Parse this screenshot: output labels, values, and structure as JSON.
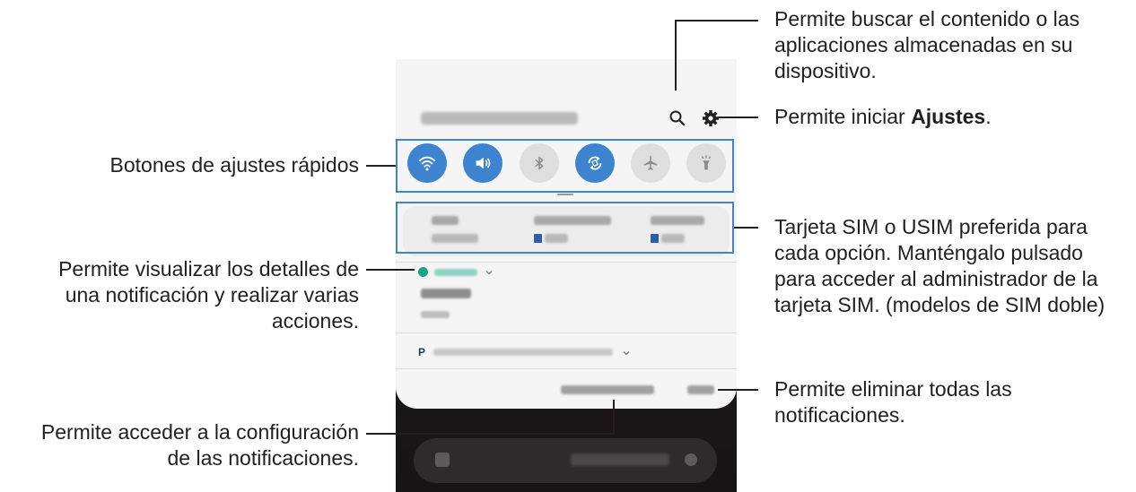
{
  "annotations": {
    "search": {
      "line1": "Permite buscar el contenido o las",
      "line2": "aplicaciones almacenadas en su",
      "line3": "dispositivo."
    },
    "settings": {
      "prefix": "Permite iniciar ",
      "bold": "Ajustes",
      "suffix": "."
    },
    "quick_settings": "Botones de ajustes rápidos",
    "sim": {
      "line1": "Tarjeta SIM o USIM preferida para",
      "line2": "cada opción. Manténgalo pulsado",
      "line3": "para acceder al administrador de la",
      "line4": "tarjeta SIM. (modelos de SIM doble)"
    },
    "notification_details": {
      "line1": "Permite visualizar los detalles de",
      "line2": "una notificación y realizar varias",
      "line3": "acciones."
    },
    "clear": {
      "line1": "Permite eliminar todas las",
      "line2": "notificaciones."
    },
    "notification_settings": {
      "line1": "Permite acceder a la configuración",
      "line2": "de las notificaciones."
    }
  },
  "phone": {
    "quick_buttons": [
      {
        "icon": "wifi-icon",
        "state": "on"
      },
      {
        "icon": "sound-icon",
        "state": "on"
      },
      {
        "icon": "bluetooth-icon",
        "state": "off"
      },
      {
        "icon": "auto-rotate-icon",
        "state": "on"
      },
      {
        "icon": "airplane-icon",
        "state": "off"
      },
      {
        "icon": "flashlight-icon",
        "state": "off"
      }
    ],
    "notification2_letter": "P"
  },
  "colors": {
    "accent": "#3e83cf",
    "highlight": "#3d87c9",
    "text": "#231f20",
    "notif_app": "#1aa383"
  }
}
